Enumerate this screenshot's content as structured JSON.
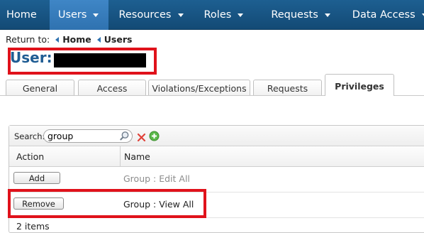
{
  "nav": {
    "items": [
      {
        "label": "Home"
      },
      {
        "label": "Users"
      },
      {
        "label": "Resources"
      },
      {
        "label": "Roles"
      },
      {
        "label": "Requests"
      },
      {
        "label": "Data Access"
      }
    ],
    "active": "Users"
  },
  "breadcrumb": {
    "prefix": "Return to:",
    "links": [
      {
        "label": "Home"
      },
      {
        "label": "Users"
      }
    ]
  },
  "user": {
    "title": "User:"
  },
  "tabs": {
    "items": [
      {
        "label": "General"
      },
      {
        "label": "Access"
      },
      {
        "label": "Violations/Exceptions"
      },
      {
        "label": "Requests"
      },
      {
        "label": "Privileges"
      }
    ],
    "active": "Privileges"
  },
  "grid": {
    "search_label": "Search:",
    "search_value": "group",
    "columns": {
      "action": "Action",
      "name": "Name"
    },
    "rows": [
      {
        "action": "Add",
        "name": "Group : Edit All"
      },
      {
        "action": "Remove",
        "name": "Group : View All"
      }
    ],
    "footer": "2 items"
  },
  "colors": {
    "nav_bg": "#134a75",
    "nav_active": "#2f72b0",
    "title": "#1f5c93",
    "highlight": "#e0121b",
    "clear_icon": "#e0433a",
    "add_icon": "#4caf3a"
  }
}
